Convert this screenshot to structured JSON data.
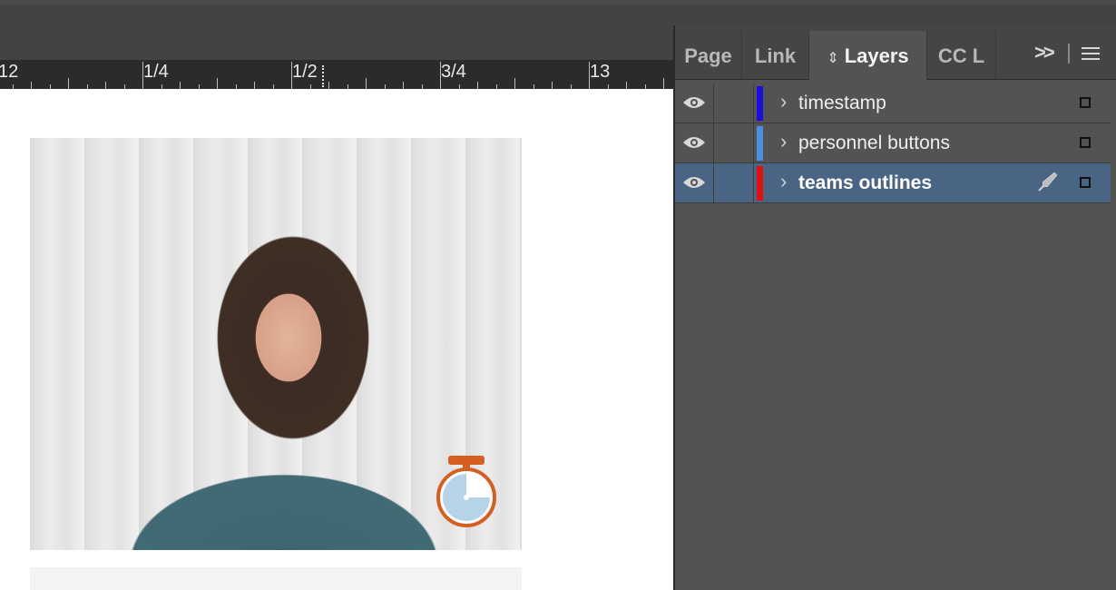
{
  "ruler": {
    "labels": [
      "12",
      "1/4",
      "1/2",
      "3/4",
      "13"
    ]
  },
  "panel": {
    "tabs": [
      {
        "label": "Page",
        "active": false
      },
      {
        "label": "Link",
        "active": false
      },
      {
        "label": "Layers",
        "active": true
      },
      {
        "label": "CC L",
        "active": false
      }
    ],
    "more_icon": "double-chevron-right-icon",
    "menu_icon": "panel-menu-icon"
  },
  "layers": [
    {
      "name": "timestamp",
      "color": "#1a0fe0",
      "visible": true,
      "selected": false
    },
    {
      "name": "personnel buttons",
      "color": "#4a90e2",
      "visible": true,
      "selected": false
    },
    {
      "name": "teams outlines",
      "color": "#e01010",
      "visible": true,
      "selected": true
    }
  ],
  "colors": {
    "selection": "#4a6584",
    "timer_accent": "#d45f23",
    "timer_fill": "#b7d3e8"
  }
}
